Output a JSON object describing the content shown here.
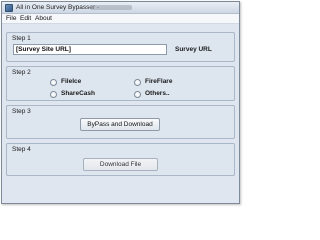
{
  "window": {
    "title": "All in One Survey Bypasser -"
  },
  "menu": [
    "File",
    "Edit",
    "About"
  ],
  "step1": {
    "label": "Step 1",
    "url_value": "[Survey Site URL]",
    "url_label": "Survey URL"
  },
  "step2": {
    "label": "Step 2",
    "options": [
      "FileIce",
      "FireFlare",
      "ShareCash",
      "Others.."
    ]
  },
  "step3": {
    "label": "Step 3",
    "button": "ByPass and Download"
  },
  "step4": {
    "label": "Step 4",
    "button": "Download File"
  }
}
